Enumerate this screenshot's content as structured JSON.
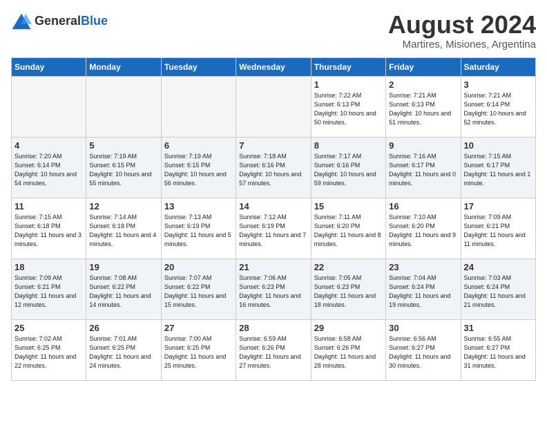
{
  "logo": {
    "general": "General",
    "blue": "Blue"
  },
  "title": "August 2024",
  "location": "Martires, Misiones, Argentina",
  "weekdays": [
    "Sunday",
    "Monday",
    "Tuesday",
    "Wednesday",
    "Thursday",
    "Friday",
    "Saturday"
  ],
  "weeks": [
    [
      {
        "day": "",
        "info": ""
      },
      {
        "day": "",
        "info": ""
      },
      {
        "day": "",
        "info": ""
      },
      {
        "day": "",
        "info": ""
      },
      {
        "day": "1",
        "info": "Sunrise: 7:22 AM\nSunset: 6:13 PM\nDaylight: 10 hours\nand 50 minutes."
      },
      {
        "day": "2",
        "info": "Sunrise: 7:21 AM\nSunset: 6:13 PM\nDaylight: 10 hours\nand 51 minutes."
      },
      {
        "day": "3",
        "info": "Sunrise: 7:21 AM\nSunset: 6:14 PM\nDaylight: 10 hours\nand 52 minutes."
      }
    ],
    [
      {
        "day": "4",
        "info": "Sunrise: 7:20 AM\nSunset: 6:14 PM\nDaylight: 10 hours\nand 54 minutes."
      },
      {
        "day": "5",
        "info": "Sunrise: 7:19 AM\nSunset: 6:15 PM\nDaylight: 10 hours\nand 55 minutes."
      },
      {
        "day": "6",
        "info": "Sunrise: 7:19 AM\nSunset: 6:15 PM\nDaylight: 10 hours\nand 56 minutes."
      },
      {
        "day": "7",
        "info": "Sunrise: 7:18 AM\nSunset: 6:16 PM\nDaylight: 10 hours\nand 57 minutes."
      },
      {
        "day": "8",
        "info": "Sunrise: 7:17 AM\nSunset: 6:16 PM\nDaylight: 10 hours\nand 59 minutes."
      },
      {
        "day": "9",
        "info": "Sunrise: 7:16 AM\nSunset: 6:17 PM\nDaylight: 11 hours\nand 0 minutes."
      },
      {
        "day": "10",
        "info": "Sunrise: 7:15 AM\nSunset: 6:17 PM\nDaylight: 11 hours\nand 1 minute."
      }
    ],
    [
      {
        "day": "11",
        "info": "Sunrise: 7:15 AM\nSunset: 6:18 PM\nDaylight: 11 hours\nand 3 minutes."
      },
      {
        "day": "12",
        "info": "Sunrise: 7:14 AM\nSunset: 6:18 PM\nDaylight: 11 hours\nand 4 minutes."
      },
      {
        "day": "13",
        "info": "Sunrise: 7:13 AM\nSunset: 6:19 PM\nDaylight: 11 hours\nand 5 minutes."
      },
      {
        "day": "14",
        "info": "Sunrise: 7:12 AM\nSunset: 6:19 PM\nDaylight: 11 hours\nand 7 minutes."
      },
      {
        "day": "15",
        "info": "Sunrise: 7:11 AM\nSunset: 6:20 PM\nDaylight: 11 hours\nand 8 minutes."
      },
      {
        "day": "16",
        "info": "Sunrise: 7:10 AM\nSunset: 6:20 PM\nDaylight: 11 hours\nand 9 minutes."
      },
      {
        "day": "17",
        "info": "Sunrise: 7:09 AM\nSunset: 6:21 PM\nDaylight: 11 hours\nand 11 minutes."
      }
    ],
    [
      {
        "day": "18",
        "info": "Sunrise: 7:09 AM\nSunset: 6:21 PM\nDaylight: 11 hours\nand 12 minutes."
      },
      {
        "day": "19",
        "info": "Sunrise: 7:08 AM\nSunset: 6:22 PM\nDaylight: 11 hours\nand 14 minutes."
      },
      {
        "day": "20",
        "info": "Sunrise: 7:07 AM\nSunset: 6:22 PM\nDaylight: 11 hours\nand 15 minutes."
      },
      {
        "day": "21",
        "info": "Sunrise: 7:06 AM\nSunset: 6:23 PM\nDaylight: 11 hours\nand 16 minutes."
      },
      {
        "day": "22",
        "info": "Sunrise: 7:05 AM\nSunset: 6:23 PM\nDaylight: 11 hours\nand 18 minutes."
      },
      {
        "day": "23",
        "info": "Sunrise: 7:04 AM\nSunset: 6:24 PM\nDaylight: 11 hours\nand 19 minutes."
      },
      {
        "day": "24",
        "info": "Sunrise: 7:03 AM\nSunset: 6:24 PM\nDaylight: 11 hours\nand 21 minutes."
      }
    ],
    [
      {
        "day": "25",
        "info": "Sunrise: 7:02 AM\nSunset: 6:25 PM\nDaylight: 11 hours\nand 22 minutes."
      },
      {
        "day": "26",
        "info": "Sunrise: 7:01 AM\nSunset: 6:25 PM\nDaylight: 11 hours\nand 24 minutes."
      },
      {
        "day": "27",
        "info": "Sunrise: 7:00 AM\nSunset: 6:25 PM\nDaylight: 11 hours\nand 25 minutes."
      },
      {
        "day": "28",
        "info": "Sunrise: 6:59 AM\nSunset: 6:26 PM\nDaylight: 11 hours\nand 27 minutes."
      },
      {
        "day": "29",
        "info": "Sunrise: 6:58 AM\nSunset: 6:26 PM\nDaylight: 11 hours\nand 28 minutes."
      },
      {
        "day": "30",
        "info": "Sunrise: 6:56 AM\nSunset: 6:27 PM\nDaylight: 11 hours\nand 30 minutes."
      },
      {
        "day": "31",
        "info": "Sunrise: 6:55 AM\nSunset: 6:27 PM\nDaylight: 11 hours\nand 31 minutes."
      }
    ]
  ]
}
